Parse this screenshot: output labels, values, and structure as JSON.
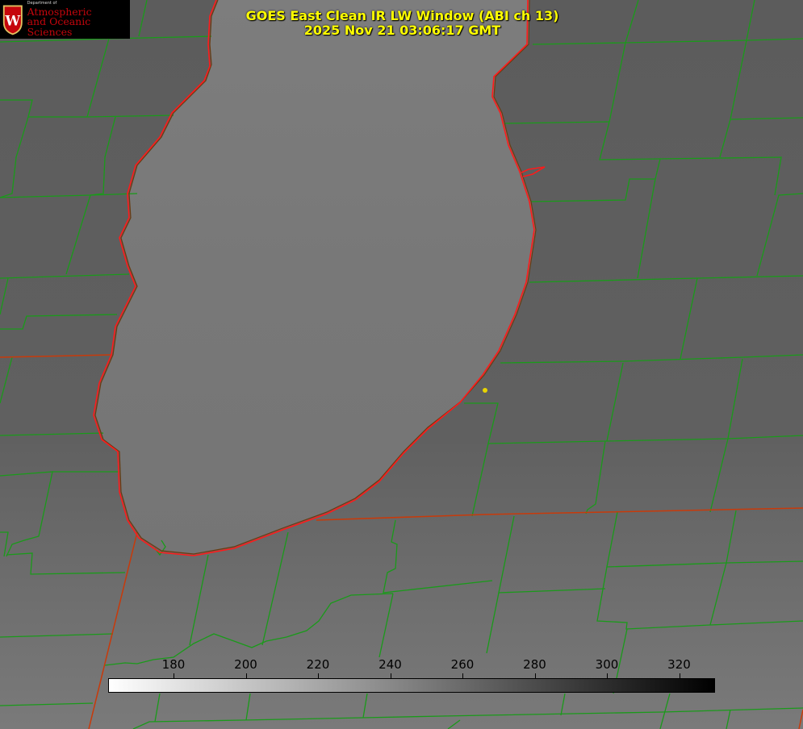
{
  "header": {
    "title_line1": "GOES East Clean IR LW Window (ABI ch 13)",
    "title_line2": "2025 Nov 21 03:06:17 GMT"
  },
  "logo": {
    "dept": "Department of",
    "line1": "Atmospheric",
    "line2": "and Oceanic Sciences",
    "crest_letter": "W"
  },
  "colorbar": {
    "ticks": [
      "180",
      "200",
      "220",
      "240",
      "260",
      "280",
      "300",
      "320"
    ],
    "gradient_start": "#ffffff",
    "gradient_end": "#000000"
  },
  "map": {
    "background_color": "#5e5e5e",
    "county_border_color": "#1a9a1a",
    "state_border_color": "#c83a0a",
    "lake_outline_color": "#ff1a1a",
    "marker_color": "#e8d400"
  }
}
